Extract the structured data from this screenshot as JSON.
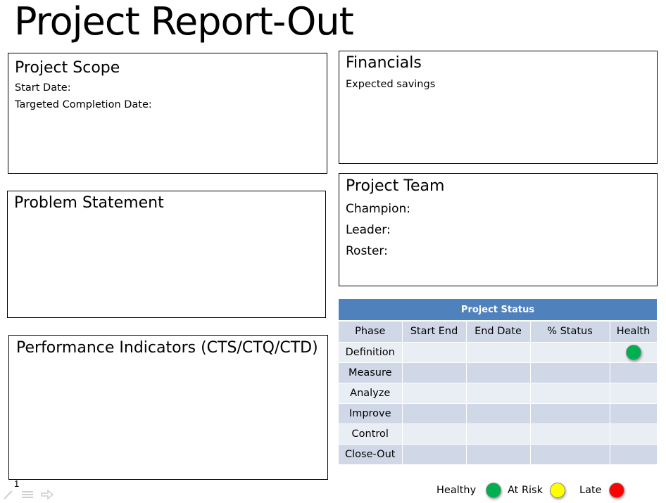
{
  "title": "Project Report-Out",
  "scope": {
    "title": "Project Scope",
    "start_date_label": "Start Date:",
    "completion_label": "Targeted Completion Date:"
  },
  "problem": {
    "title": "Problem Statement"
  },
  "performance": {
    "title": "Performance Indicators (CTS/CTQ/CTD)"
  },
  "financials": {
    "title": "Financials",
    "expected_label": "Expected savings"
  },
  "team": {
    "title": "Project Team",
    "champion_label": "Champion:",
    "leader_label": "Leader:",
    "roster_label": "Roster:"
  },
  "status": {
    "caption": "Project Status",
    "header_color": "#4f81bd",
    "columns": [
      "Phase",
      "Start End",
      "End Date",
      "% Status",
      "Health"
    ],
    "rows": [
      {
        "phase": "Definition",
        "health": "healthy"
      },
      {
        "phase": "Measure",
        "health": ""
      },
      {
        "phase": "Analyze",
        "health": ""
      },
      {
        "phase": "Improve",
        "health": ""
      },
      {
        "phase": "Control",
        "health": ""
      },
      {
        "phase": "Close-Out",
        "health": ""
      }
    ]
  },
  "legend": {
    "healthy_label": "Healthy",
    "healthy_color": "#00b050",
    "risk_label": "At Risk",
    "risk_color": "#ffff00",
    "late_label": "Late",
    "late_color": "#ff0000"
  },
  "footer": {
    "slide_number": "1",
    "icons": [
      "pen-icon",
      "menu-icon",
      "next-arrow-icon"
    ]
  }
}
